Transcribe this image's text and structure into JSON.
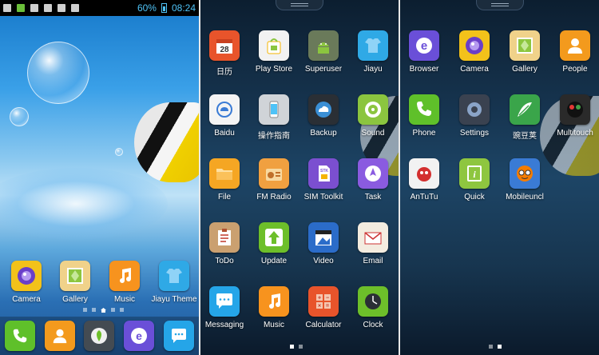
{
  "status_bar": {
    "battery_percent": "60%",
    "time": "08:24"
  },
  "panel1": {
    "apps": [
      {
        "label": "Camera",
        "icon": "camera-lens-icon",
        "color": "#f3c21a"
      },
      {
        "label": "Gallery",
        "icon": "gallery-leaf-icon",
        "color": "#f0d28a"
      },
      {
        "label": "Music",
        "icon": "music-note-icon",
        "color": "#f7931e"
      },
      {
        "label": "Jiayu Theme",
        "icon": "shirt-icon",
        "color": "#2fa9e6"
      }
    ],
    "dock": [
      {
        "name": "phone",
        "icon": "phone-icon",
        "color": "#5fc02a"
      },
      {
        "name": "people",
        "icon": "person-icon",
        "color": "#f39a1d"
      },
      {
        "name": "browser-alt",
        "icon": "leaf-logo-icon",
        "color": "#444b52"
      },
      {
        "name": "browser",
        "icon": "browser-e-icon",
        "color": "#6a4fd8"
      },
      {
        "name": "messaging",
        "icon": "chat-bubble-icon",
        "color": "#25a5e8"
      }
    ]
  },
  "panel2": {
    "apps": [
      {
        "label": "日历",
        "icon": "calendar-icon",
        "color": "#e8542b",
        "glyph": "28"
      },
      {
        "label": "Play Store",
        "icon": "shopping-bag-icon",
        "color": "#f2f2f2"
      },
      {
        "label": "Superuser",
        "icon": "android-robot-icon",
        "color": "#6a7a5a"
      },
      {
        "label": "Jiayu",
        "icon": "shirt-icon",
        "color": "#2fa9e6"
      },
      {
        "label": "Baidu",
        "icon": "cloud-icon",
        "color": "#f4f4f4"
      },
      {
        "label": "操作指南",
        "icon": "phone-guide-icon",
        "color": "#d0d4d8"
      },
      {
        "label": "Backup",
        "icon": "cloud-backup-icon",
        "color": "#2a2f35"
      },
      {
        "label": "Sound",
        "icon": "speaker-icon",
        "color": "#8bc53f"
      },
      {
        "label": "File",
        "icon": "folder-icon",
        "color": "#f5a623"
      },
      {
        "label": "FM Radio",
        "icon": "radio-icon",
        "color": "#f0a040"
      },
      {
        "label": "SIM Toolkit",
        "icon": "sim-card-icon",
        "color": "#7b4fd0"
      },
      {
        "label": "Task",
        "icon": "task-rocket-icon",
        "color": "#8a5be0"
      },
      {
        "label": "ToDo",
        "icon": "clipboard-icon",
        "color": "#caa070"
      },
      {
        "label": "Update",
        "icon": "arrow-up-icon",
        "color": "#6dbf2a"
      },
      {
        "label": "Video",
        "icon": "clapper-icon",
        "color": "#2b6cc9"
      },
      {
        "label": "Email",
        "icon": "envelope-icon",
        "color": "#f3ece0"
      },
      {
        "label": "Messaging",
        "icon": "chat-bubble-icon",
        "color": "#25a5e8"
      },
      {
        "label": "Music",
        "icon": "music-note-icon",
        "color": "#f7931e"
      },
      {
        "label": "Calculator",
        "icon": "calculator-icon",
        "color": "#e8542b"
      },
      {
        "label": "Clock",
        "icon": "clock-icon",
        "color": "#6dbf2a"
      }
    ]
  },
  "panel3": {
    "apps": [
      {
        "label": "Browser",
        "icon": "browser-e-icon",
        "color": "#6a4fd8"
      },
      {
        "label": "Camera",
        "icon": "camera-lens-icon",
        "color": "#f3c21a"
      },
      {
        "label": "Gallery",
        "icon": "gallery-leaf-icon",
        "color": "#f0d28a"
      },
      {
        "label": "People",
        "icon": "person-icon",
        "color": "#f39a1d"
      },
      {
        "label": "Phone",
        "icon": "phone-icon",
        "color": "#5fc02a"
      },
      {
        "label": "Settings",
        "icon": "gear-icon",
        "color": "#3a4250"
      },
      {
        "label": "豌豆荚",
        "icon": "pea-pod-icon",
        "color": "#3aa54a"
      },
      {
        "label": "Multitouch",
        "icon": "multitouch-icon",
        "color": "#2a2a2a"
      },
      {
        "label": "AnTuTu",
        "icon": "antutu-icon",
        "color": "#f2f2f2"
      },
      {
        "label": "Quick",
        "icon": "info-icon",
        "color": "#8ec63f"
      },
      {
        "label": "Mobileuncl",
        "icon": "mobileuncle-icon",
        "color": "#3a7bd5"
      }
    ]
  }
}
